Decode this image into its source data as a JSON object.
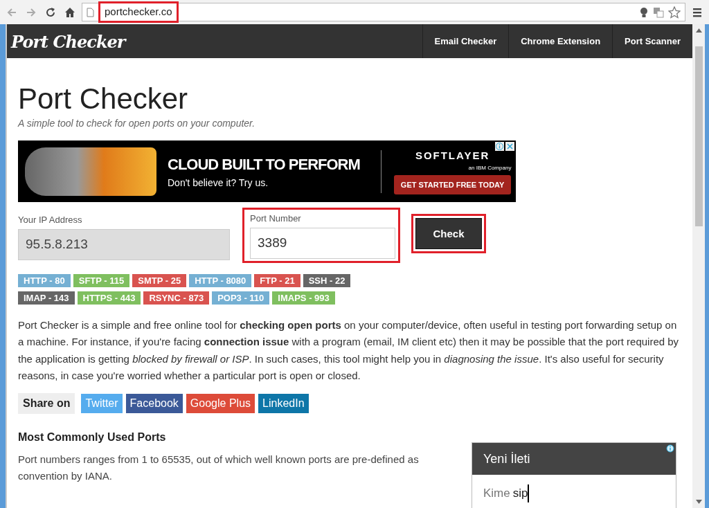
{
  "browser": {
    "url": "portchecker.co",
    "url_highlighted": true
  },
  "navbar": {
    "logo": "Port Checker",
    "links": [
      {
        "label": "Email Checker"
      },
      {
        "label": "Chrome Extension"
      },
      {
        "label": "Port Scanner"
      }
    ]
  },
  "page": {
    "title": "Port Checker",
    "subtitle": "A simple tool to check for open ports on your computer."
  },
  "ad": {
    "headline": "CLOUD BUILT TO PERFORM",
    "tagline": "Don't believe it? Try us.",
    "brand": "SOFTLAYER",
    "brand_sub": "an IBM Company",
    "cta": "GET STARTED FREE TODAY"
  },
  "form": {
    "ip_label": "Your IP Address",
    "ip_value": "95.5.8.213",
    "port_label": "Port Number",
    "port_value": "3389",
    "port_highlighted": true,
    "button": "Check",
    "button_highlighted": true
  },
  "port_tags": [
    {
      "label": "HTTP - 80",
      "color": "#75b0d3"
    },
    {
      "label": "SFTP - 115",
      "color": "#7fbf5f"
    },
    {
      "label": "SMTP - 25",
      "color": "#d9534f"
    },
    {
      "label": "HTTP - 8080",
      "color": "#75b0d3"
    },
    {
      "label": "FTP - 21",
      "color": "#d9534f"
    },
    {
      "label": "SSH - 22",
      "color": "#666666"
    },
    {
      "label": "IMAP - 143",
      "color": "#666666"
    },
    {
      "label": "HTTPS - 443",
      "color": "#7fbf5f"
    },
    {
      "label": "RSYNC - 873",
      "color": "#d9534f"
    },
    {
      "label": "POP3 - 110",
      "color": "#75b0d3"
    },
    {
      "label": "IMAPS - 993",
      "color": "#7fbf5f"
    }
  ],
  "description": "Port Checker is a simple and free online tool for **checking open ports** on your computer/device, often useful in testing port forwarding setup on a machine. For instance, if you're facing **connection issue** with a program (email, IM client etc) then it may be possible that the port required by the application is getting *blocked by firewall or ISP*. In such cases, this tool might help you in *diagnosing the issue*. It's also useful for security reasons, in case you're worried whether a particular port is open or closed.",
  "share": {
    "label": "Share on",
    "buttons": [
      {
        "label": "Twitter",
        "color": "#55acee"
      },
      {
        "label": "Facebook",
        "color": "#3b5998"
      },
      {
        "label": "Google Plus",
        "color": "#dd4b39"
      },
      {
        "label": "LinkedIn",
        "color": "#0e76a8"
      }
    ]
  },
  "ports_section": {
    "heading": "Most Commonly Used Ports",
    "text": "Port numbers ranges from 1 to 65535, out of which well known ports are pre-defined as convention by IANA."
  },
  "chat_widget": {
    "title": "Yeni İleti",
    "to_label": "Kime",
    "to_value": "sip"
  }
}
